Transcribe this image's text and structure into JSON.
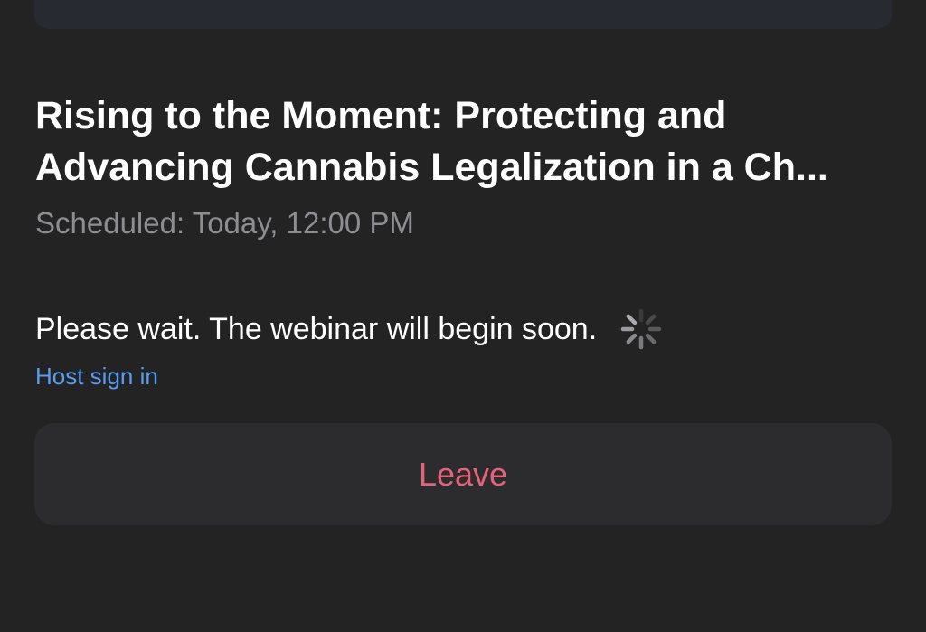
{
  "webinar": {
    "title_line1": "Rising to the Moment: Protecting and",
    "title_line2": "Advancing Cannabis Legalization in a Ch...",
    "scheduled": "Scheduled: Today, 12:00 PM"
  },
  "status": {
    "message": "Please wait. The webinar will begin soon.",
    "icon": "loading-spinner-icon"
  },
  "host_link": "Host sign in",
  "leave_button": "Leave",
  "colors": {
    "background": "#232323",
    "card": "#2c2c2e",
    "link": "#5a9cf0",
    "leave": "#e46379",
    "muted": "#8d8d92"
  }
}
